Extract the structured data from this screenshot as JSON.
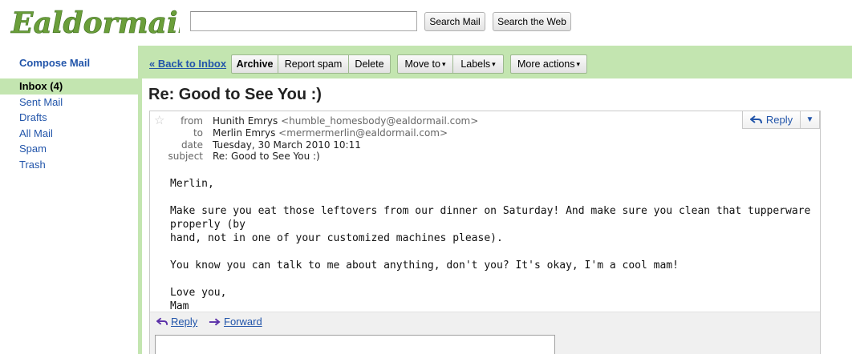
{
  "header": {
    "logo_text": "Ealdormail",
    "search_value": "",
    "search_mail_label": "Search Mail",
    "search_web_label": "Search the Web"
  },
  "sidebar": {
    "compose_label": "Compose Mail",
    "items": [
      {
        "label": "Inbox (4)",
        "active": true
      },
      {
        "label": "Sent Mail"
      },
      {
        "label": "Drafts"
      },
      {
        "label": "All Mail"
      },
      {
        "label": "Spam"
      },
      {
        "label": "Trash"
      }
    ]
  },
  "toolbar": {
    "back_label": "« Back to Inbox",
    "archive_label": "Archive",
    "spam_label": "Report spam",
    "delete_label": "Delete",
    "move_label": "Move to",
    "labels_label": "Labels",
    "more_label": "More actions",
    "caret": "▾"
  },
  "message": {
    "title": "Re: Good to See You :)",
    "star": "☆",
    "from_label": "from",
    "from_name": "Hunith Emrys",
    "from_addr": "<humble_homesbody@ealdormail.com>",
    "to_label": "to",
    "to_name": "Merlin Emrys",
    "to_addr": "<mermermerlin@ealdormail.com>",
    "date_label": "date",
    "date_value": "Tuesday, 30 March 2010 10:11",
    "subject_label": "subject",
    "subject_value": "Re: Good to See You :)",
    "reply_label": "Reply",
    "reply_dropdown": "▼",
    "body": [
      "Merlin,",
      "Make sure you eat those leftovers from our dinner on Saturday! And make sure you clean that tupperware properly (by\nhand, not in one of your customized machines please).",
      "You know you can talk to me about anything, don't you? It's okay, I'm a cool mam!",
      "Love you,\nMam"
    ]
  },
  "footer": {
    "reply_label": "Reply",
    "forward_label": "Forward",
    "reply_icon": "↶",
    "forward_icon": "➔"
  },
  "colors": {
    "accent_green": "#c3e5b0",
    "link_blue": "#2255aa",
    "logo_green": "#4e8a2e"
  }
}
